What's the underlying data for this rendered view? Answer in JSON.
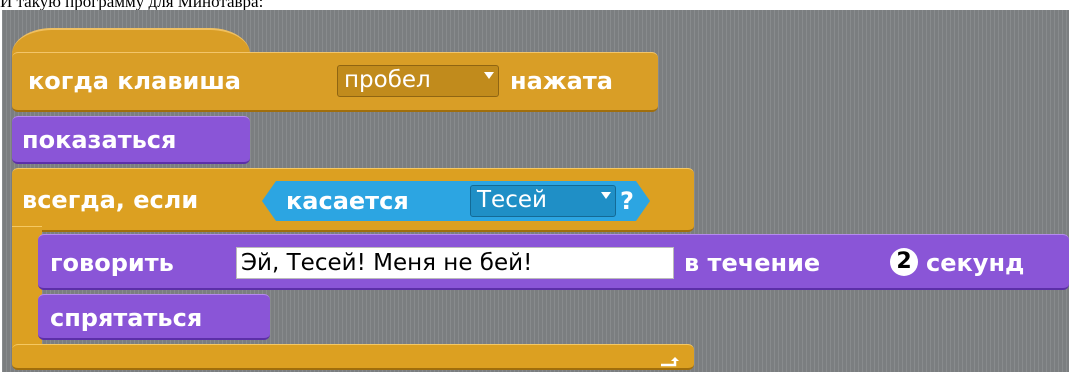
{
  "caption": "И такую программу для Минотавра:",
  "script": {
    "hat_block": {
      "label_before": "когда клавиша",
      "key_value": "пробел",
      "label_after": "нажата"
    },
    "show_block": {
      "label": "показаться"
    },
    "forever_if_block": {
      "label": "всегда, если",
      "condition": {
        "label": "касается",
        "target_value": "Тесей",
        "question": "?"
      }
    },
    "say_block": {
      "label": "говорить",
      "message": "Эй, Тесей! Меня не бей!",
      "label_middle": "в течение",
      "seconds_value": "2",
      "label_after": "секунд"
    },
    "hide_block": {
      "label": "спрятаться"
    },
    "loop_icon": "loop-arrow-icon"
  },
  "colors": {
    "events": "#d99e26",
    "control": "#dca021",
    "looks": "#8a55d7",
    "sensing": "#2ca5e2",
    "canvas": "#7b7e80"
  }
}
